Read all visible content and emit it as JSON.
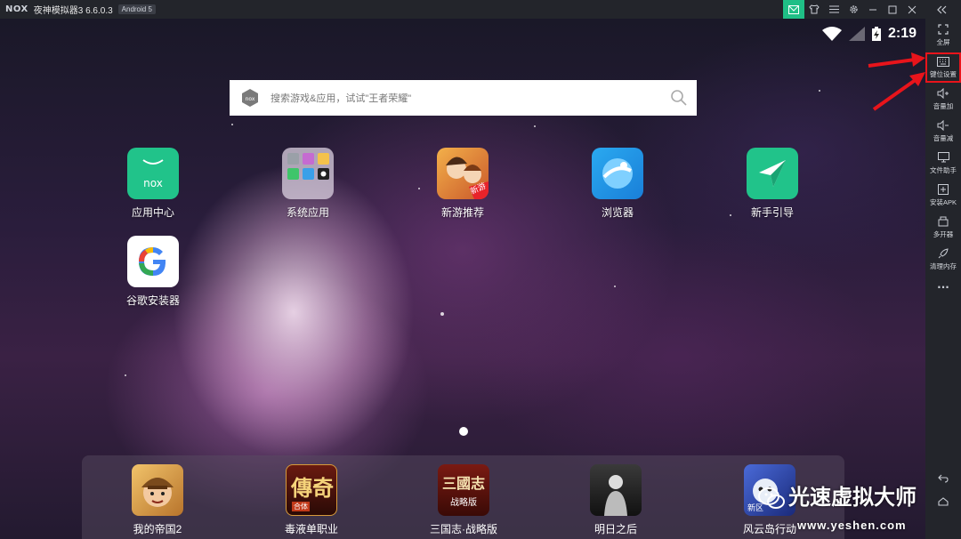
{
  "titlebar": {
    "logo": "NOX",
    "title": "夜神模拟器3 6.6.0.3",
    "android_badge": "Android 5",
    "icons": [
      "mail-icon",
      "shirt-icon",
      "menu-icon",
      "settings-icon",
      "minimize-icon",
      "maximize-icon",
      "close-icon",
      "collapse-icon"
    ]
  },
  "status_bar": {
    "time": "2:19"
  },
  "search": {
    "placeholder": "搜索游戏&应用，试试\"王者荣耀\""
  },
  "apps": [
    {
      "label": "应用中心"
    },
    {
      "label": "系统应用"
    },
    {
      "label": "新游推荐",
      "badge": "新游"
    },
    {
      "label": "浏览器"
    },
    {
      "label": "新手引导"
    },
    {
      "label": "谷歌安装器"
    }
  ],
  "dock": [
    {
      "label": "我的帝国2"
    },
    {
      "label": "毒液单职业",
      "icon_text": "傳奇",
      "icon_subtext": "合体"
    },
    {
      "label": "三国志·战略版",
      "icon_text": "三國志",
      "icon_subtext": "战略版"
    },
    {
      "label": "明日之后"
    },
    {
      "label": "风云岛行动",
      "icon_text": "新区"
    }
  ],
  "sidebar": [
    {
      "label": "全屏",
      "icon": "fullscreen-icon"
    },
    {
      "label": "键位设置",
      "icon": "keyboard-icon",
      "highlighted": true
    },
    {
      "label": "音量加",
      "icon": "volume-up-icon"
    },
    {
      "label": "音量减",
      "icon": "volume-down-icon"
    },
    {
      "label": "文件助手",
      "icon": "monitor-icon"
    },
    {
      "label": "安装APK",
      "icon": "install-apk-icon"
    },
    {
      "label": "多开器",
      "icon": "multi-instance-icon"
    },
    {
      "label": "清理内存",
      "icon": "rocket-icon"
    },
    {
      "label": "···",
      "icon": "more-icon"
    }
  ],
  "watermark": {
    "title": "光速虚拟大师",
    "url": "www.yeshen.com"
  },
  "colors": {
    "accent_green": "#1fbf86",
    "highlight_red": "#e8141b",
    "sidebar_bg": "#23252b"
  }
}
